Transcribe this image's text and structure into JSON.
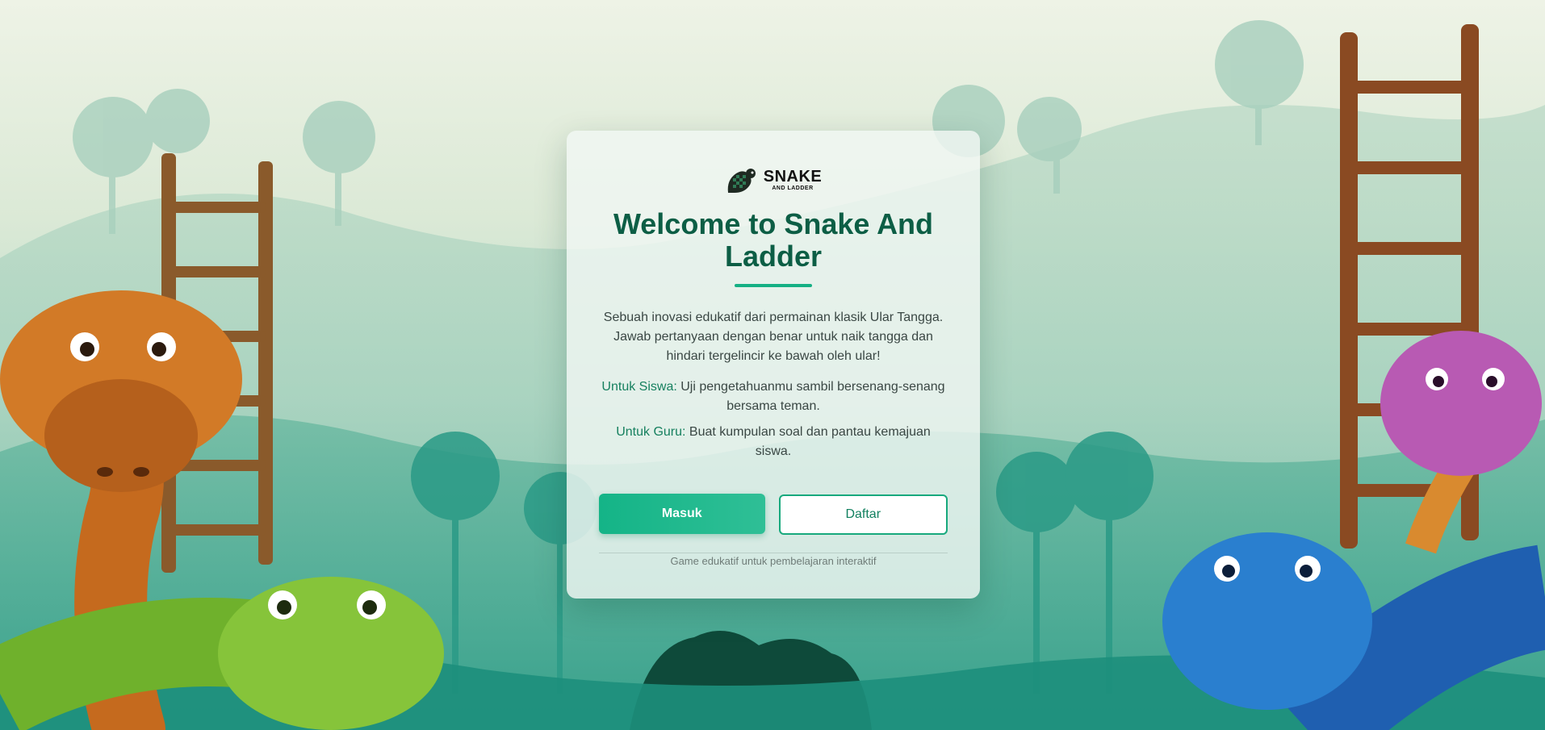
{
  "logo": {
    "line1": "SNAKE",
    "line2": "AND LADDER"
  },
  "title": "Welcome to Snake And Ladder",
  "description": "Sebuah inovasi edukatif dari permainan klasik Ular Tangga. Jawab pertanyaan dengan benar untuk naik tangga dan hindari tergelincir ke bawah oleh ular!",
  "roles": [
    {
      "label": "Untuk Siswa:",
      "text": " Uji pengetahuanmu sambil bersenang-senang bersama teman."
    },
    {
      "label": "Untuk Guru:",
      "text": " Buat kumpulan soal dan pantau kemajuan siswa."
    }
  ],
  "buttons": {
    "login": "Masuk",
    "register": "Daftar"
  },
  "footnote": "Game edukatif untuk pembelajaran interaktif",
  "colors": {
    "title": "#0c5e45",
    "accent": "#15b084",
    "role_label": "#16805f"
  },
  "icons": {
    "logo": "checkered-snake-logo-icon"
  }
}
